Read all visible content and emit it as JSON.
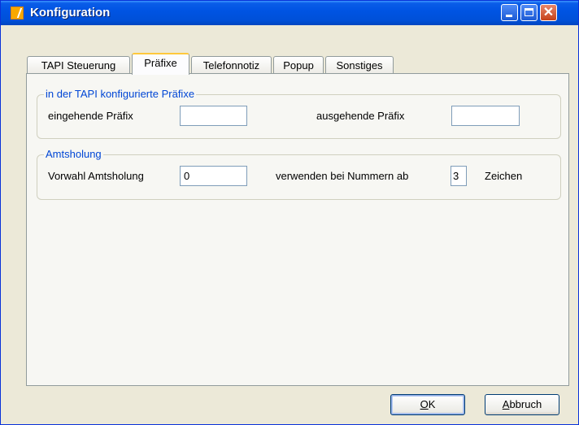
{
  "window": {
    "title": "Konfiguration"
  },
  "tabs": [
    {
      "label": "TAPI Steuerung",
      "active": false
    },
    {
      "label": "Präfixe",
      "active": true
    },
    {
      "label": "Telefonnotiz",
      "active": false
    },
    {
      "label": "Popup",
      "active": false
    },
    {
      "label": "Sonstiges",
      "active": false
    }
  ],
  "prefixes": {
    "legend": "in der TAPI konfigurierte Präfixe",
    "incoming_label": "eingehende Präfix",
    "incoming_value": "",
    "outgoing_label": "ausgehende Präfix",
    "outgoing_value": ""
  },
  "outside_line": {
    "legend": "Amtsholung",
    "prefix_label": "Vorwahl Amtsholung",
    "prefix_value": "0",
    "min_digits_label": "verwenden bei Nummern ab",
    "min_digits_value": "3",
    "unit_label": "Zeichen"
  },
  "buttons": {
    "ok_mnemonic": "O",
    "ok_rest": "K",
    "cancel_mnemonic": "A",
    "cancel_rest": "bbruch"
  },
  "colors": {
    "title_bar": "#0054e3",
    "group_legend": "#0046d5",
    "active_tab_highlight": "#ffc83c"
  }
}
